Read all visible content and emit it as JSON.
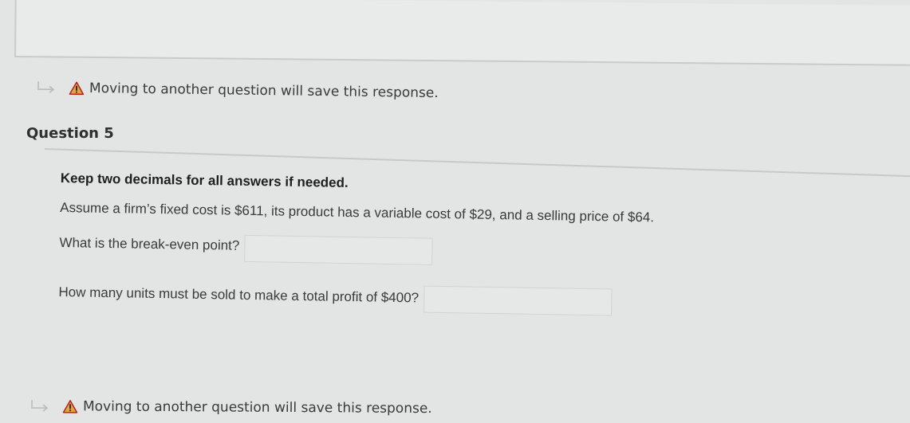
{
  "previous_notice": {
    "icon": "return-arrow-icon",
    "warning_icon": "warning-triangle-icon",
    "text": "Moving to another question will save this response."
  },
  "question": {
    "title": "Question 5",
    "instruction": "Keep two decimals for all answers if needed.",
    "prompt": "Assume a firm’s fixed cost is $611, its product has a variable cost of $29, and a selling price of $64.",
    "parts": [
      {
        "label": "What is the break-even point?",
        "value": ""
      },
      {
        "label": "How many units must be sold to make a total profit of $400?",
        "value": ""
      }
    ]
  },
  "bottom_notice": {
    "icon": "return-arrow-icon",
    "warning_icon": "warning-triangle-icon",
    "text": "Moving to another question will save this response."
  },
  "colors": {
    "background": "#e3e4e4",
    "warning_fill": "#e8a33d",
    "warning_border": "#b52020"
  }
}
